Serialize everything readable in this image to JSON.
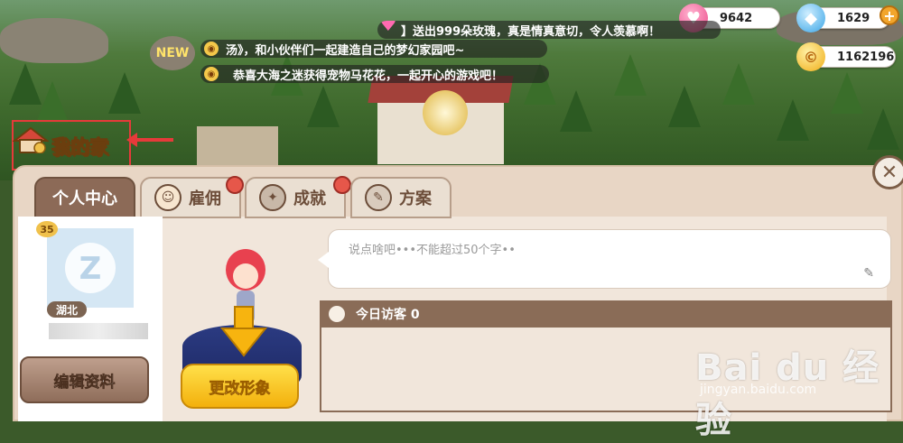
{
  "resources": {
    "hearts": "9642",
    "diamonds": "1629",
    "coins": "1162196",
    "hearts_icon": "heart-icon",
    "diamond_icon": "diamond-icon",
    "coin_icon": "coin-icon",
    "add_icon": "plus-icon"
  },
  "messages": [
    "】送出999朵玫瑰，真是情真意切，令人羡慕啊！",
    "汤》，和小伙伴们一起建造自己的梦幻家园吧~",
    "恭喜大海之迷获得宠物马花花，一起开心的游戏吧！"
  ],
  "scene": {
    "new_badge": "NEW"
  },
  "home": {
    "title": "我的家"
  },
  "tabs": [
    {
      "label": "个人中心",
      "icon": ""
    },
    {
      "label": "雇佣",
      "icon": "worker-face-icon"
    },
    {
      "label": "成就",
      "icon": "winged-badge-icon"
    },
    {
      "label": "方案",
      "icon": "scroll-icon"
    }
  ],
  "profile": {
    "level": "35",
    "region": "湖北",
    "edit_label": "编辑资料"
  },
  "avatar": {
    "change_label": "更改形象"
  },
  "message_box": {
    "placeholder": "说点啥吧•••不能超过50个字••"
  },
  "visitors": {
    "label": "今日访客 0"
  },
  "watermark": {
    "brand": "Bai du 经验",
    "url": "jingyan.baidu.com"
  },
  "colors": {
    "panel_bg": "#e8d6c5",
    "tab_active": "#8c6a57",
    "button_yellow": "#f3b00c",
    "highlight_red": "#e63a3a"
  }
}
